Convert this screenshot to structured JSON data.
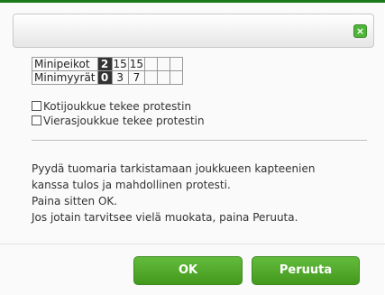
{
  "dialog": {
    "close_icon_glyph": "×"
  },
  "stats": {
    "rows": [
      {
        "label": "Minipeikot",
        "current": "2",
        "values": [
          "15",
          "15",
          "",
          "",
          ""
        ]
      },
      {
        "label": "Minimyyrät",
        "current": "0",
        "values": [
          "3",
          "7",
          "",
          "",
          ""
        ]
      }
    ]
  },
  "options": {
    "home_protest": {
      "label": "Kotijoukkue tekee protestin",
      "checked": false
    },
    "away_protest": {
      "label": "Vierasjoukkue tekee protestin",
      "checked": false
    }
  },
  "message": {
    "line1": "Pyydä tuomaria tarkistamaan joukkueen kapteenien",
    "line2": "kanssa tulos ja mahdollinen protesti.",
    "line3": "Paina sitten OK.",
    "line4": "Jos jotain tarvitsee vielä muokata, paina Peruuta."
  },
  "buttons": {
    "ok_label": "OK",
    "cancel_label": "Peruuta"
  },
  "colors": {
    "accent_green": "#4fb43a",
    "current_cell": "#333333",
    "top_line": "#1a7a1a"
  }
}
